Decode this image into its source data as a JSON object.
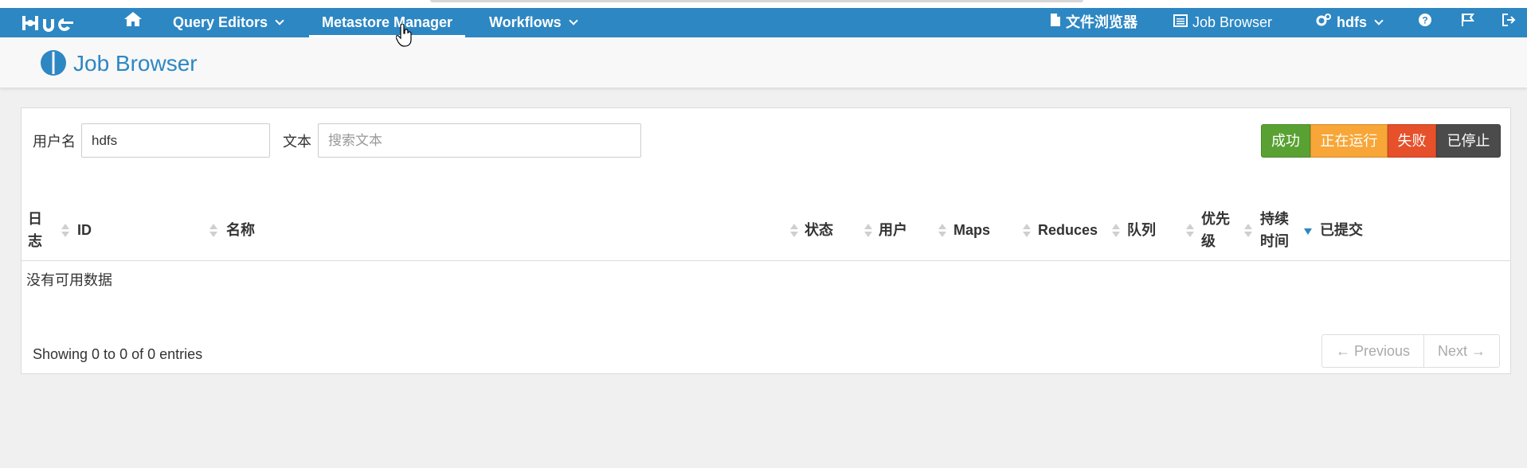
{
  "nav": {
    "logo": "HUE",
    "home_icon": "home-icon",
    "items": [
      {
        "label": "Query Editors",
        "dropdown": true
      },
      {
        "label": "Metastore Manager",
        "active": true
      },
      {
        "label": "Workflows",
        "dropdown": true
      }
    ],
    "right": {
      "file_browser": "文件浏览器",
      "job_browser": "Job Browser",
      "user": "hdfs",
      "icons": [
        "help-icon",
        "flag-icon",
        "logout-icon"
      ]
    },
    "color": "#2d87c3"
  },
  "header": {
    "title": "Job Browser",
    "icon": "job-browser-icon"
  },
  "filters": {
    "user_label": "用户名",
    "user_value": "hdfs",
    "text_label": "文本",
    "text_placeholder": "搜索文本"
  },
  "status_buttons": [
    {
      "label": "成功",
      "color": "#5aa134"
    },
    {
      "label": "正在运行",
      "color": "#f7a637"
    },
    {
      "label": "失败",
      "color": "#e6502a"
    },
    {
      "label": "已停止",
      "color": "#4b4b4b"
    }
  ],
  "table": {
    "columns": [
      "日志",
      "ID",
      "名称",
      "状态",
      "用户",
      "Maps",
      "Reduces",
      "队列",
      "优先级",
      "持续时间",
      "已提交"
    ],
    "columns_display": {
      "log_1": "日",
      "log_2": "志",
      "priority_1": "优先",
      "priority_2": "级",
      "duration_1": "持续",
      "duration_2": "时间"
    },
    "sorted_column": "已提交",
    "empty_text": "没有可用数据"
  },
  "footer": {
    "entries": "Showing 0 to 0 of 0 entries",
    "previous": "← Previous",
    "next": "Next →"
  }
}
